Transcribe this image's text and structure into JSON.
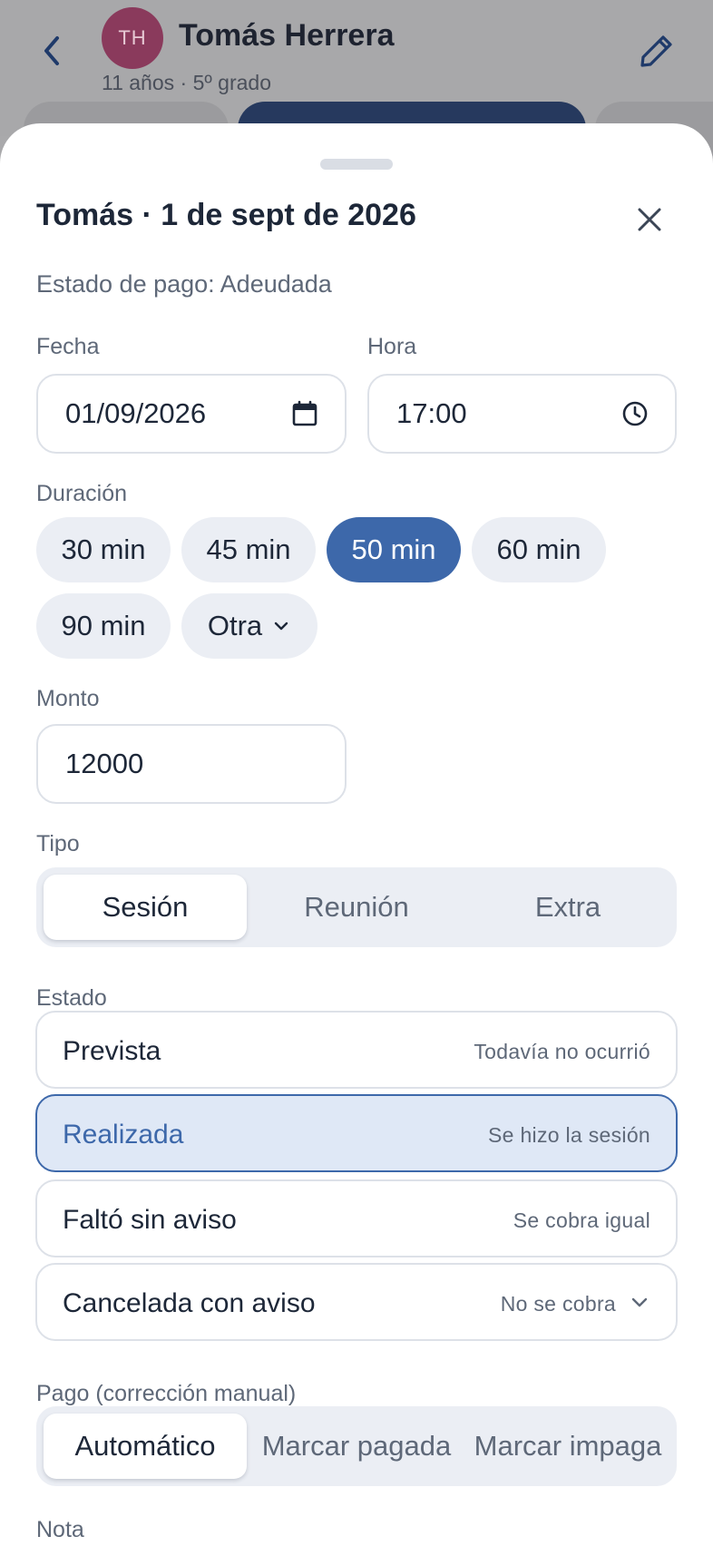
{
  "header": {
    "back_icon": "chevron-left-icon",
    "avatar_initials": "TH",
    "name": "Tomás Herrera",
    "subtitle": "11 años · 5º grado",
    "edit_icon": "pencil-icon"
  },
  "sheet": {
    "title": "Tomás · 1 de sept de 2026",
    "close_icon": "close-icon",
    "payment_status": "Estado de pago: Adeudada",
    "date_label": "Fecha",
    "date_value": "01/09/2026",
    "time_label": "Hora",
    "time_value": "17:00",
    "duration_label": "Duración",
    "durations": [
      "30 min",
      "45 min",
      "50 min",
      "60 min",
      "90 min",
      "Otra"
    ],
    "duration_selected": "50 min",
    "amount_label": "Monto",
    "amount_value": "12000",
    "type_label": "Tipo",
    "types": [
      "Sesión",
      "Reunión",
      "Extra"
    ],
    "type_selected": "Sesión",
    "state_label": "Estado",
    "states": [
      {
        "name": "Prevista",
        "desc": "Todavía no ocurrió"
      },
      {
        "name": "Realizada",
        "desc": "Se hizo la sesión"
      },
      {
        "name": "Faltó sin aviso",
        "desc": "Se cobra igual"
      },
      {
        "name": "Cancelada con aviso",
        "desc": "No se cobra"
      }
    ],
    "state_selected": "Realizada",
    "payment_label": "Pago (corrección manual)",
    "payment_options": [
      "Automático",
      "Marcar pagada",
      "Marcar impaga"
    ],
    "payment_selected": "Automático",
    "note_label": "Nota"
  },
  "colors": {
    "accent": "#3d68aa",
    "overlay": "#a9a9ab",
    "avatar": "#8a3a5c"
  }
}
